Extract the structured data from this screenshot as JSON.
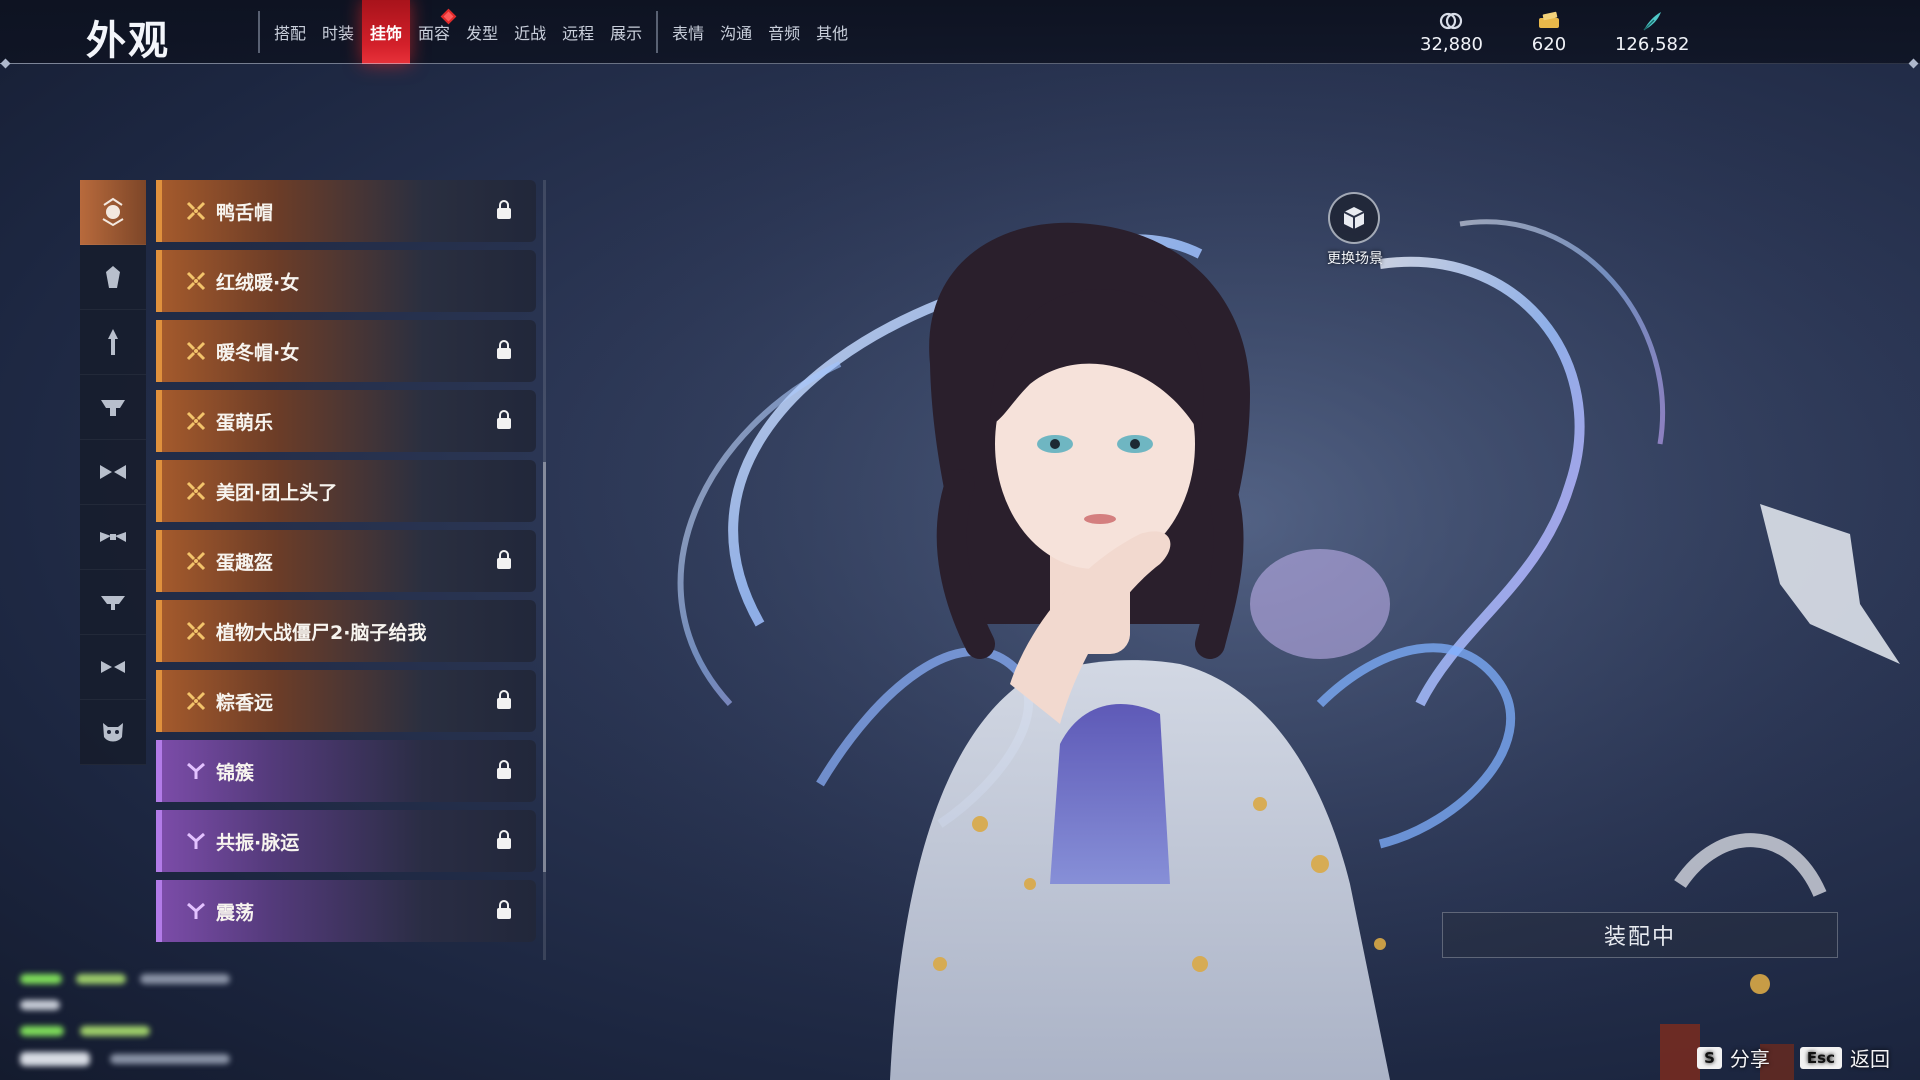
{
  "header": {
    "title": "外观",
    "tabs": [
      {
        "label": "搭配"
      },
      {
        "label": "时装"
      },
      {
        "label": "挂饰"
      },
      {
        "label": "面容"
      },
      {
        "label": "发型"
      },
      {
        "label": "近战"
      },
      {
        "label": "远程"
      },
      {
        "label": "展示"
      },
      {
        "label": "表情"
      },
      {
        "label": "沟通"
      },
      {
        "label": "音频"
      },
      {
        "label": "其他"
      }
    ],
    "active_tab": "挂饰"
  },
  "currencies": [
    {
      "name": "coin-icon",
      "value": "32,880",
      "color": "#d8dde8"
    },
    {
      "name": "ticket-icon",
      "value": "620",
      "color": "#e8b84a"
    },
    {
      "name": "feather-icon",
      "value": "126,582",
      "color": "#4fc8c8"
    }
  ],
  "categories": [
    {
      "icon": "head-ornament-icon",
      "active": true
    },
    {
      "icon": "face-ornament-icon"
    },
    {
      "icon": "hair-ornament-icon"
    },
    {
      "icon": "waist-ornament-icon"
    },
    {
      "icon": "back-ornament-icon"
    },
    {
      "icon": "wing-ornament-icon"
    },
    {
      "icon": "shoulder-ornament-icon"
    },
    {
      "icon": "bow-ornament-icon"
    },
    {
      "icon": "mask-ornament-icon"
    }
  ],
  "items": [
    {
      "label": "鸭舌帽",
      "rarity": "orange",
      "locked": true
    },
    {
      "label": "红绒暖·女",
      "rarity": "orange",
      "locked": false
    },
    {
      "label": "暖冬帽·女",
      "rarity": "orange",
      "locked": true
    },
    {
      "label": "蛋萌乐",
      "rarity": "orange",
      "locked": true
    },
    {
      "label": "美团·团上头了",
      "rarity": "orange",
      "locked": false
    },
    {
      "label": "蛋趣盔",
      "rarity": "orange",
      "locked": true
    },
    {
      "label": "植物大战僵尸2·脑子给我",
      "rarity": "orange",
      "locked": false
    },
    {
      "label": "粽香远",
      "rarity": "orange",
      "locked": true
    },
    {
      "label": "锦簇",
      "rarity": "purple",
      "locked": true
    },
    {
      "label": "共振·脉运",
      "rarity": "purple",
      "locked": true
    },
    {
      "label": "震荡",
      "rarity": "purple",
      "locked": true
    }
  ],
  "scene": {
    "change_scene_label": "更换场景",
    "equipped_label": "装配中"
  },
  "hotkeys": [
    {
      "key": "S",
      "label": "分享"
    },
    {
      "key": "Esc",
      "label": "返回"
    }
  ],
  "colors": {
    "accent_red": "#d3202a",
    "rarity_orange": "#e0913d",
    "rarity_purple": "#b27be8"
  }
}
